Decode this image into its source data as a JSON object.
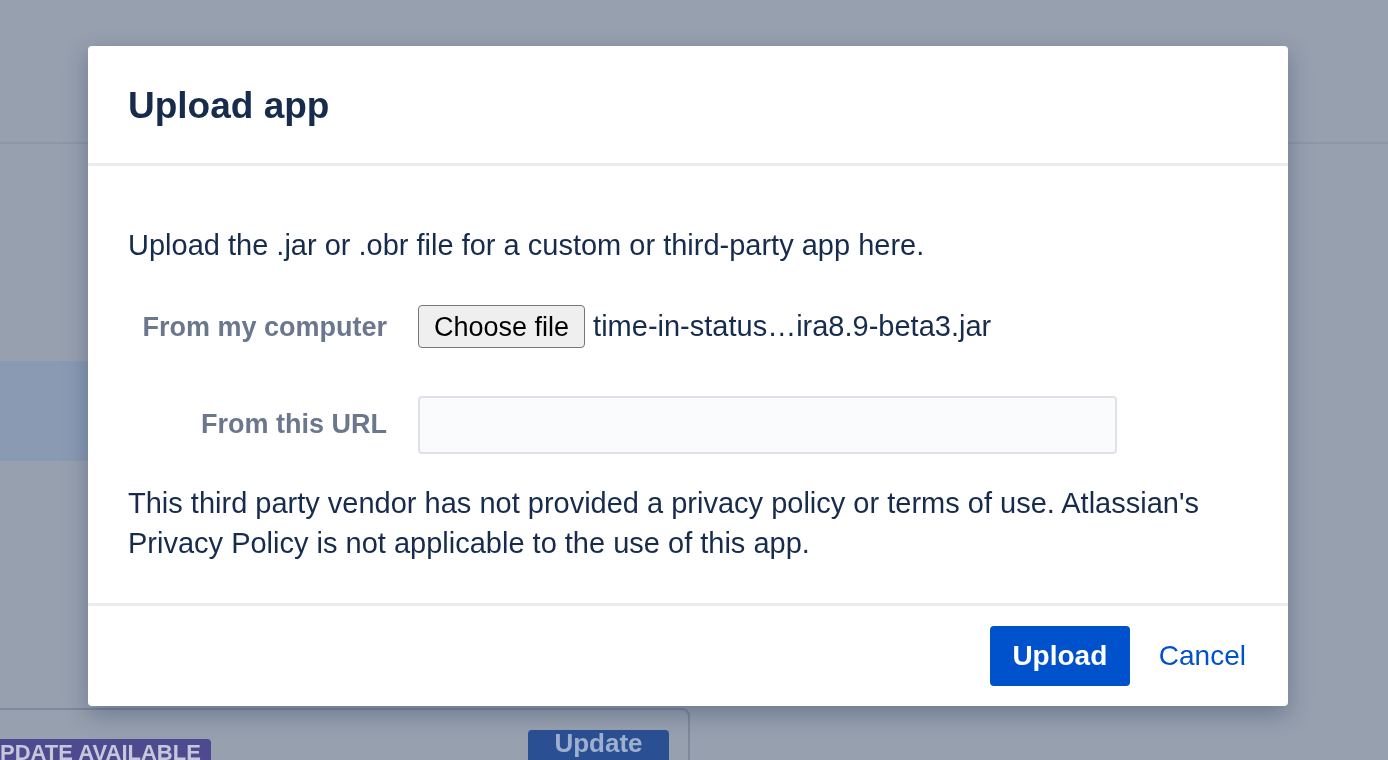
{
  "background": {
    "card": {
      "badge": "PDATE AVAILABLE",
      "button": "Update"
    }
  },
  "dialog": {
    "title": "Upload app",
    "intro": "Upload the .jar or .obr file for a custom or third-party app here.",
    "fields": [
      {
        "kind": "file",
        "label": "From my computer",
        "button": "Choose file",
        "value": "time-in-status…ira8.9-beta3.jar"
      },
      {
        "kind": "text",
        "label": "From this URL"
      }
    ],
    "notice": "This third party vendor has not provided a privacy policy or terms of use. Atlassian's Privacy Policy is not applicable to the use of this app.",
    "buttons": [
      {
        "kind": "primary",
        "label": "Upload"
      },
      {
        "kind": "link",
        "label": "Cancel"
      }
    ]
  }
}
